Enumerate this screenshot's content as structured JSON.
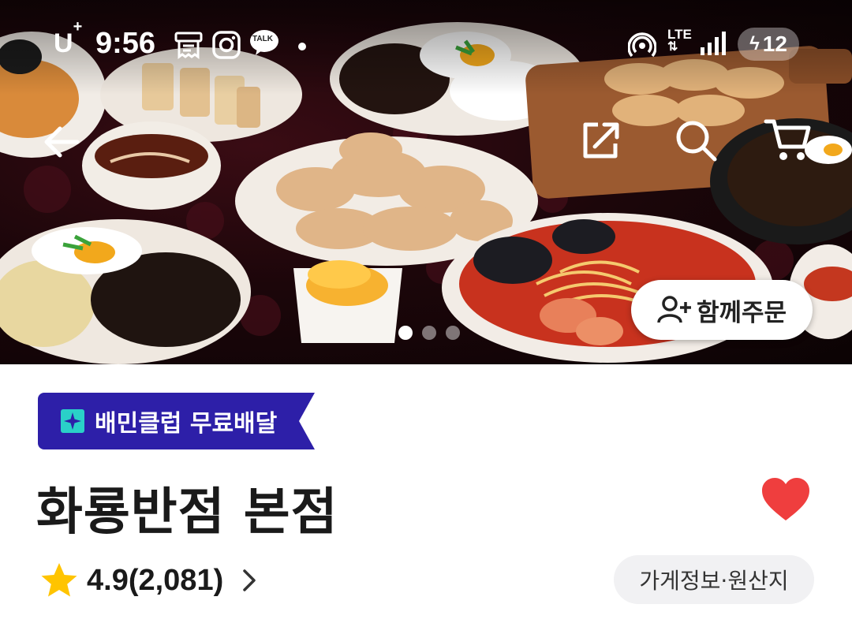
{
  "status_bar": {
    "carrier": "U",
    "carrier_sup": "+",
    "time": "9:56",
    "notification_icons": [
      "receipt-icon",
      "instagram-icon",
      "kakaotalk-icon"
    ],
    "talk_label": "TALK",
    "network": "LTE",
    "battery_level": "12"
  },
  "hero": {
    "carousel_total": 3,
    "carousel_active": 1,
    "group_order_label": "함께주문"
  },
  "badge": {
    "label": "배민클럽 무료배달",
    "color": "#2d1fa8"
  },
  "store": {
    "name": "화룡반점 본점",
    "favorited": true,
    "heart_color": "#ef3e3e"
  },
  "rating": {
    "display": "4.9(2,081)",
    "star_color": "#ffc400"
  },
  "info_chip": {
    "label": "가게정보·원산지"
  }
}
